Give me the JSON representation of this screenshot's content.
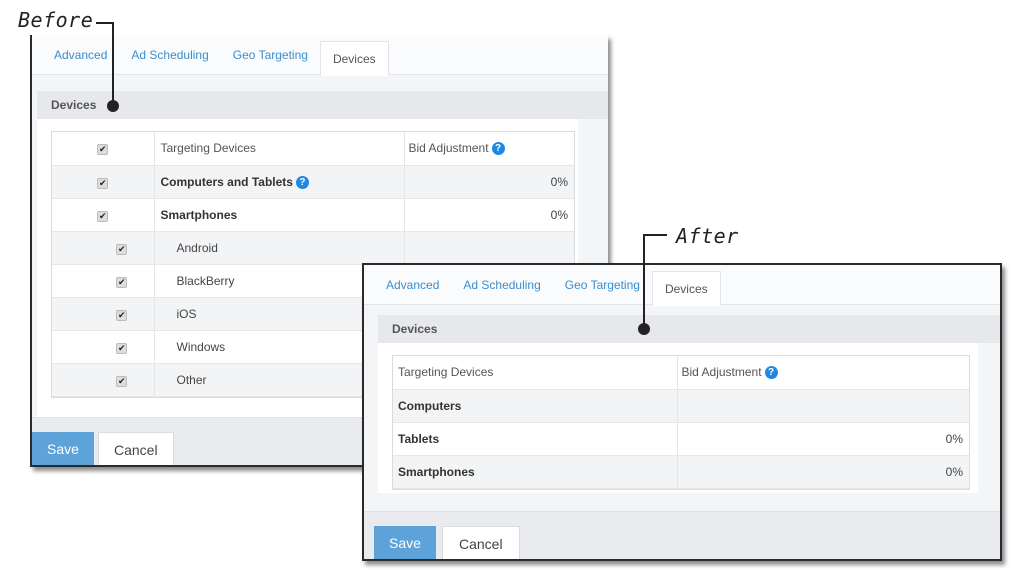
{
  "callouts": {
    "before": "Before",
    "after": "After"
  },
  "before": {
    "tabs": [
      "Advanced",
      "Ad Scheduling",
      "Geo Targeting",
      "Devices"
    ],
    "active_tab": "Devices",
    "section_title": "Devices",
    "table": {
      "headers": {
        "name": "Targeting Devices",
        "bid": "Bid Adjustment"
      },
      "rows": [
        {
          "name": "Computers and Tablets",
          "bid": "0%",
          "checked": true,
          "bold": true,
          "help": true
        },
        {
          "name": "Smartphones",
          "bid": "0%",
          "checked": true,
          "bold": true
        },
        {
          "name": "Android",
          "bid": "",
          "checked": true
        },
        {
          "name": "BlackBerry",
          "bid": "",
          "checked": true
        },
        {
          "name": "iOS",
          "bid": "",
          "checked": true
        },
        {
          "name": "Windows",
          "bid": "",
          "checked": true
        },
        {
          "name": "Other",
          "bid": "",
          "checked": true
        }
      ]
    },
    "buttons": {
      "save": "Save",
      "cancel": "Cancel"
    }
  },
  "after": {
    "tabs": [
      "Advanced",
      "Ad Scheduling",
      "Geo Targeting",
      "Devices"
    ],
    "active_tab": "Devices",
    "section_title": "Devices",
    "table": {
      "headers": {
        "name": "Targeting Devices",
        "bid": "Bid Adjustment"
      },
      "rows": [
        {
          "name": "Computers",
          "bid": ""
        },
        {
          "name": "Tablets",
          "bid": "0%"
        },
        {
          "name": "Smartphones",
          "bid": "0%"
        }
      ]
    },
    "buttons": {
      "save": "Save",
      "cancel": "Cancel"
    }
  },
  "icons": {
    "check": "✔",
    "help": "?"
  },
  "colors": {
    "link": "#3c8dcc",
    "save": "#5da3d9",
    "help": "#1e88e5"
  }
}
